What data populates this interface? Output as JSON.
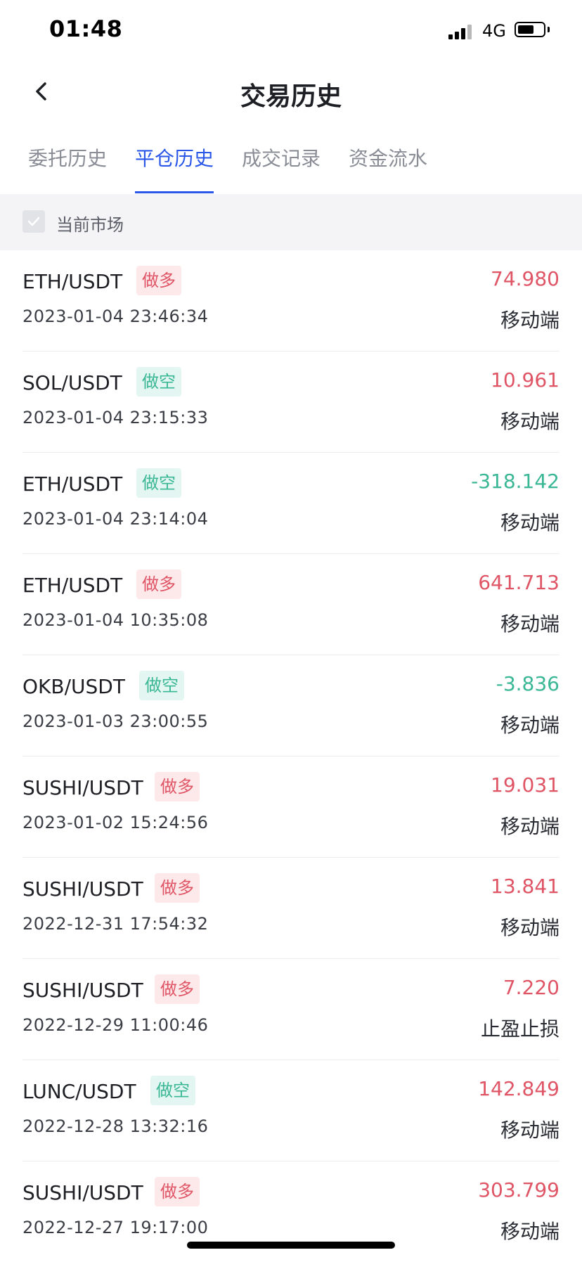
{
  "status_bar": {
    "time": "01:48",
    "network": "4G",
    "battery_level": 0.65
  },
  "nav": {
    "title": "交易历史",
    "back_icon": "chevron-left-icon"
  },
  "tabs": [
    {
      "label": "委托历史",
      "active": false
    },
    {
      "label": "平仓历史",
      "active": true
    },
    {
      "label": "成交记录",
      "active": false
    },
    {
      "label": "资金流水",
      "active": false
    }
  ],
  "filter": {
    "label": "当前市场",
    "checked": true
  },
  "colors": {
    "accent": "#2a57e8",
    "profit": "#e05566",
    "loss": "#3ab795",
    "long_tag_bg": "#fde9ea",
    "short_tag_bg": "#e4f6f1"
  },
  "positions": [
    {
      "pair": "ETH/USDT",
      "side": "做多",
      "side_type": "long",
      "datetime": "2023-01-04 23:46:34",
      "pnl": "74.980",
      "pnl_type": "pos",
      "source": "移动端"
    },
    {
      "pair": "SOL/USDT",
      "side": "做空",
      "side_type": "short",
      "datetime": "2023-01-04 23:15:33",
      "pnl": "10.961",
      "pnl_type": "pos",
      "source": "移动端"
    },
    {
      "pair": "ETH/USDT",
      "side": "做空",
      "side_type": "short",
      "datetime": "2023-01-04 23:14:04",
      "pnl": "-318.142",
      "pnl_type": "neg",
      "source": "移动端"
    },
    {
      "pair": "ETH/USDT",
      "side": "做多",
      "side_type": "long",
      "datetime": "2023-01-04 10:35:08",
      "pnl": "641.713",
      "pnl_type": "pos",
      "source": "移动端"
    },
    {
      "pair": "OKB/USDT",
      "side": "做空",
      "side_type": "short",
      "datetime": "2023-01-03 23:00:55",
      "pnl": "-3.836",
      "pnl_type": "neg",
      "source": "移动端"
    },
    {
      "pair": "SUSHI/USDT",
      "side": "做多",
      "side_type": "long",
      "datetime": "2023-01-02 15:24:56",
      "pnl": "19.031",
      "pnl_type": "pos",
      "source": "移动端"
    },
    {
      "pair": "SUSHI/USDT",
      "side": "做多",
      "side_type": "long",
      "datetime": "2022-12-31 17:54:32",
      "pnl": "13.841",
      "pnl_type": "pos",
      "source": "移动端"
    },
    {
      "pair": "SUSHI/USDT",
      "side": "做多",
      "side_type": "long",
      "datetime": "2022-12-29 11:00:46",
      "pnl": "7.220",
      "pnl_type": "pos",
      "source": "止盈止损"
    },
    {
      "pair": "LUNC/USDT",
      "side": "做空",
      "side_type": "short",
      "datetime": "2022-12-28 13:32:16",
      "pnl": "142.849",
      "pnl_type": "pos",
      "source": "移动端"
    },
    {
      "pair": "SUSHI/USDT",
      "side": "做多",
      "side_type": "long",
      "datetime": "2022-12-27 19:17:00",
      "pnl": "303.799",
      "pnl_type": "pos",
      "source": "移动端"
    }
  ]
}
